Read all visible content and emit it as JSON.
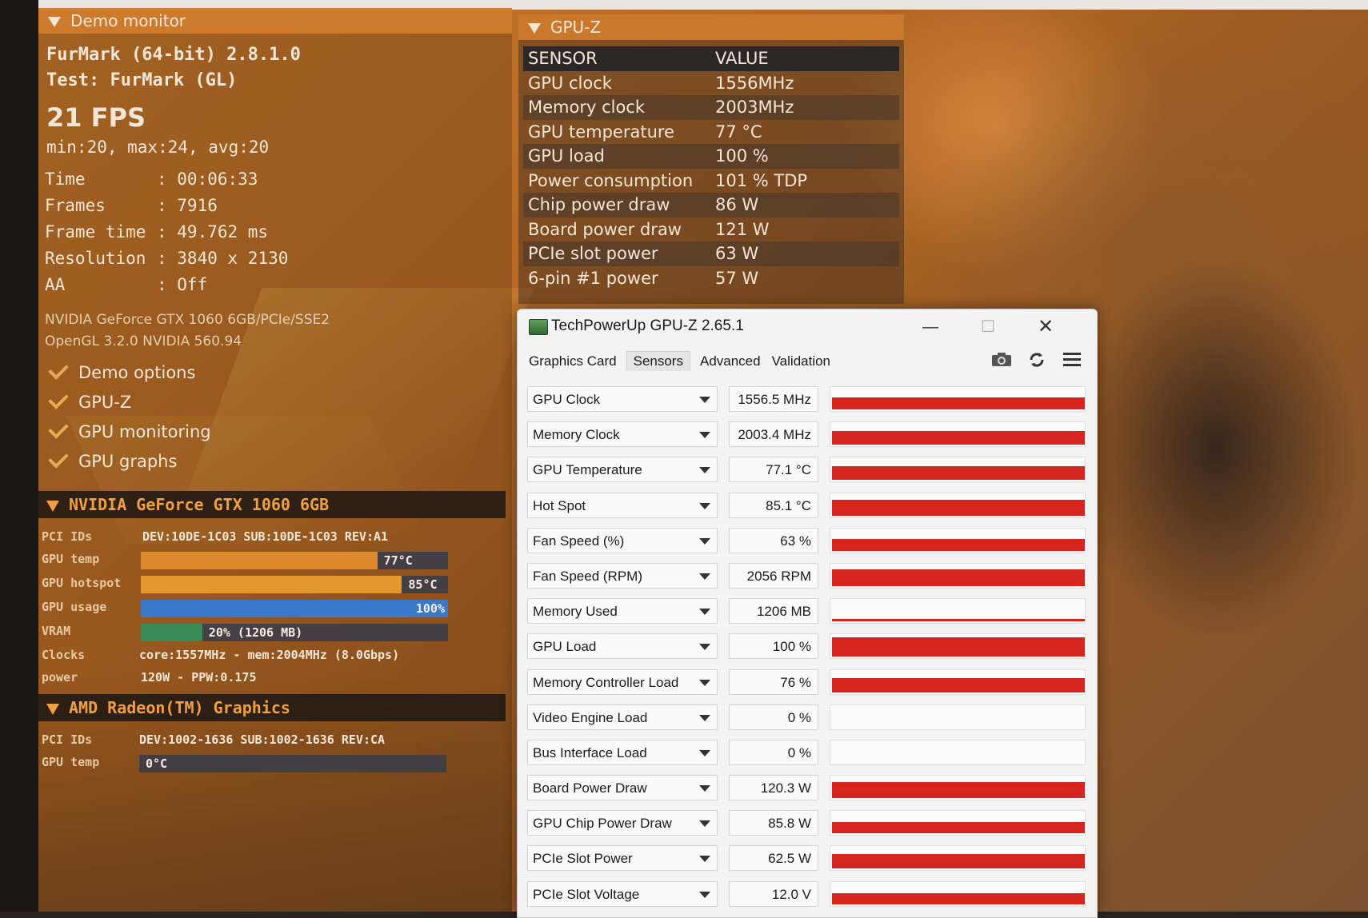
{
  "demo_monitor": {
    "title": "Demo monitor",
    "app_line": "FurMark (64-bit) 2.8.1.0",
    "test_line": "Test: FurMark (GL)",
    "fps": "21 FPS",
    "fps_stats": "min:20, max:24, avg:20",
    "stats": [
      {
        "key": "Time",
        "value": ": 00:06:33"
      },
      {
        "key": "Frames",
        "value": ": 7916"
      },
      {
        "key": "Frame time",
        "value": ": 49.762 ms"
      },
      {
        "key": "Resolution",
        "value": ": 3840 x 2130"
      },
      {
        "key": "AA",
        "value": ": Off"
      }
    ],
    "renderer": "NVIDIA GeForce GTX 1060 6GB/PCIe/SSE2",
    "opengl": "OpenGL 3.2.0 NVIDIA 560.94",
    "options": [
      "Demo options",
      "GPU-Z",
      "GPU monitoring",
      "GPU graphs"
    ],
    "gpus": [
      {
        "name": "NVIDIA GeForce GTX 1060 6GB",
        "pci_label": "PCI IDs",
        "pci_value": "DEV:10DE-1C03 SUB:10DE-1C03 REV:A1",
        "temp_label": "GPU temp",
        "temp_text": "77°C",
        "temp_fraction": 0.77,
        "hotspot_label": "GPU hotspot",
        "hotspot_text": "85°C",
        "hotspot_fraction": 0.85,
        "usage_label": "GPU usage",
        "usage_text": "100%",
        "usage_fraction": 1.0,
        "vram_label": "VRAM",
        "vram_text": "20% (1206 MB)",
        "vram_fraction": 0.2,
        "clocks_label": "Clocks",
        "clocks_value": "core:1557MHz - mem:2004MHz (8.0Gbps)",
        "power_label": "power",
        "power_value": "120W - PPW:0.175"
      },
      {
        "name": "AMD Radeon(TM) Graphics",
        "pci_label": "PCI IDs",
        "pci_value": "DEV:1002-1636 SUB:1002-1636 REV:CA",
        "temp_label": "GPU temp",
        "temp_text": "0°C",
        "temp_fraction": 0.0
      }
    ],
    "colors": {
      "temp_bar": "#e08a2e",
      "hotspot_bar": "#e6962e",
      "usage_bar": "#3a78c8",
      "vram_bar": "#3a8a55"
    }
  },
  "gpuz_overlay": {
    "title": "GPU-Z",
    "header": {
      "sensor": "SENSOR",
      "value": "VALUE"
    },
    "rows": [
      {
        "sensor": "GPU clock",
        "value": "1556MHz"
      },
      {
        "sensor": "Memory clock",
        "value": "2003MHz"
      },
      {
        "sensor": "GPU temperature",
        "value": "77 °C"
      },
      {
        "sensor": "GPU load",
        "value": "100 %"
      },
      {
        "sensor": "Power consumption",
        "value": "101 % TDP"
      },
      {
        "sensor": "Chip power draw",
        "value": "86 W"
      },
      {
        "sensor": "Board power draw",
        "value": "121 W"
      },
      {
        "sensor": "PCIe slot power",
        "value": "63 W"
      },
      {
        "sensor": "6-pin #1 power",
        "value": "57 W"
      }
    ]
  },
  "gpuz_window": {
    "title": "TechPowerUp GPU-Z 2.65.1",
    "controls": {
      "minimize": "—",
      "maximize": "☐",
      "close": "✕"
    },
    "tabs": [
      "Graphics Card",
      "Sensors",
      "Advanced",
      "Validation"
    ],
    "active_tab": "Sensors",
    "toolbar_icons": [
      "camera-icon",
      "refresh-icon",
      "menu-icon"
    ],
    "sensors": [
      {
        "name": "GPU Clock",
        "value": "1556.5 MHz",
        "level": 0.55
      },
      {
        "name": "Memory Clock",
        "value": "2003.4 MHz",
        "level": 0.6
      },
      {
        "name": "GPU Temperature",
        "value": "77.1 °C",
        "level": 0.62
      },
      {
        "name": "Hot Spot",
        "value": "85.1 °C",
        "level": 0.7
      },
      {
        "name": "Fan Speed (%)",
        "value": "63 %",
        "level": 0.55
      },
      {
        "name": "Fan Speed (RPM)",
        "value": "2056 RPM",
        "level": 0.75
      },
      {
        "name": "Memory Used",
        "value": "1206 MB",
        "level": 0.12
      },
      {
        "name": "GPU Load",
        "value": "100 %",
        "level": 0.85
      },
      {
        "name": "Memory Controller Load",
        "value": "76 %",
        "level": 0.65
      },
      {
        "name": "Video Engine Load",
        "value": "0 %",
        "level": 0.0
      },
      {
        "name": "Bus Interface Load",
        "value": "0 %",
        "level": 0.0
      },
      {
        "name": "Board Power Draw",
        "value": "120.3 W",
        "level": 0.7
      },
      {
        "name": "GPU Chip Power Draw",
        "value": "85.8 W",
        "level": 0.5
      },
      {
        "name": "PCIe Slot Power",
        "value": "62.5 W",
        "level": 0.65
      },
      {
        "name": "PCIe Slot Voltage",
        "value": "12.0 V",
        "level": 0.5
      }
    ],
    "graph_color": "#d6241e"
  }
}
